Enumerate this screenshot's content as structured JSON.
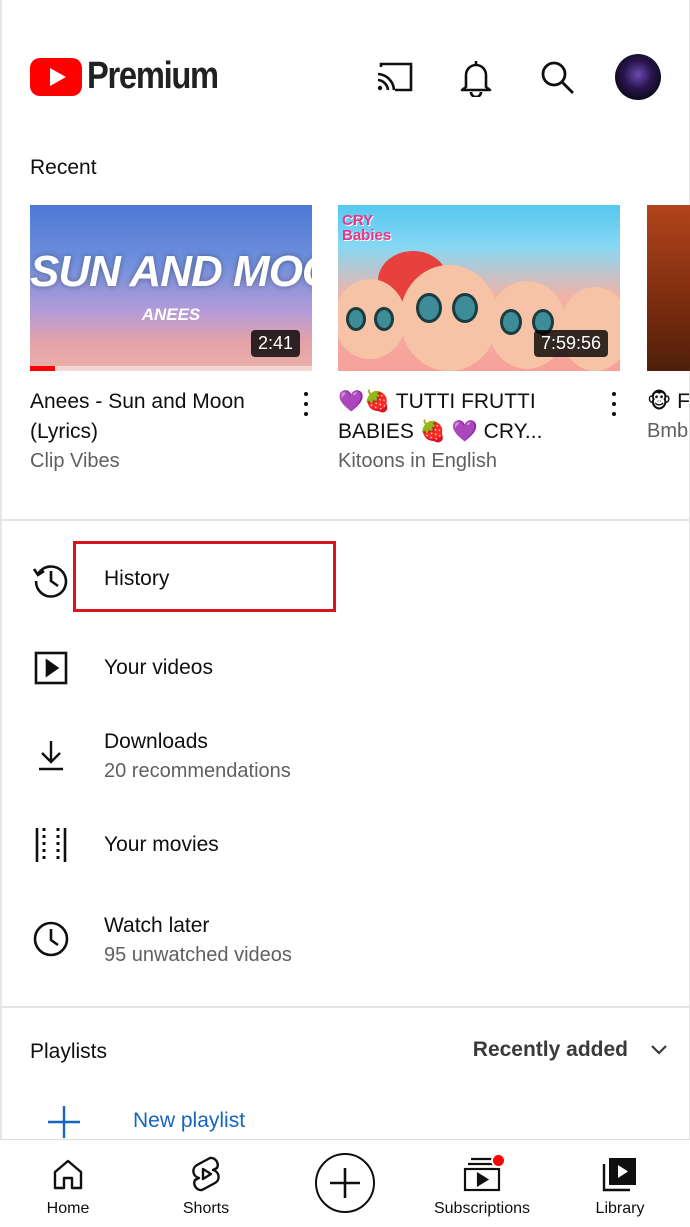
{
  "header": {
    "brand": "Premium",
    "icons": [
      "cast-icon",
      "notifications-bell-icon",
      "search-icon",
      "account-avatar"
    ]
  },
  "recent": {
    "title": "Recent",
    "videos": [
      {
        "thumb_text": "SUN AND MOON",
        "thumb_subtext": "ANEES",
        "duration": "2:41",
        "progress": 0.09,
        "title": "Anees - Sun and Moon (Lyrics)",
        "channel": "Clip Vibes"
      },
      {
        "thumb_text": "CRY Babies",
        "duration": "7:59:56",
        "progress": 0.0,
        "title": "💜🍓 TUTTI FRUTTI BABIES 🍓 💜 CRY...",
        "channel": "Kitoons in English"
      },
      {
        "title": "🐵 F 🍌+",
        "channel": "Bmb"
      }
    ]
  },
  "menu": {
    "history": {
      "label": "History"
    },
    "your_videos": {
      "label": "Your videos"
    },
    "downloads": {
      "label": "Downloads",
      "sub": "20 recommendations"
    },
    "your_movies": {
      "label": "Your movies"
    },
    "watch_later": {
      "label": "Watch later",
      "sub": "95 unwatched videos"
    }
  },
  "playlists": {
    "title": "Playlists",
    "sort_label": "Recently added",
    "new_playlist": "New playlist"
  },
  "bottom_nav": {
    "home": "Home",
    "shorts": "Shorts",
    "subscriptions": "Subscriptions",
    "library": "Library"
  },
  "colors": {
    "brand_red": "#FF0000",
    "highlight_box": "#D9141B",
    "link_blue": "#1565C0",
    "secondary_text": "#606060"
  }
}
